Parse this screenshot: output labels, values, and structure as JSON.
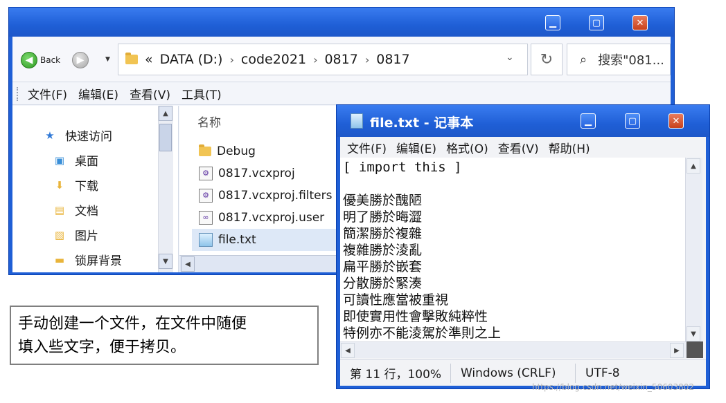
{
  "explorer": {
    "buttons": {
      "minimize": "▁",
      "maximize": "▢",
      "close": "✕"
    },
    "nav": {
      "back_label": "Back",
      "back_icon": "arrow-left-icon",
      "forward_icon": "arrow-right-icon"
    },
    "address": {
      "prefix": "«",
      "segments": [
        "DATA (D:)",
        "code2021",
        "0817",
        "0817"
      ],
      "separator": "›",
      "refresh": "↻"
    },
    "search": {
      "placeholder": "搜索\"081..."
    },
    "menu": [
      "文件(F)",
      "编辑(E)",
      "查看(V)",
      "工具(T)"
    ],
    "sidebar": {
      "items": [
        {
          "label": "快速访问",
          "icon": "star-icon",
          "glyph": "★",
          "color": "#2f78d6"
        },
        {
          "label": "桌面",
          "icon": "desktop-icon",
          "glyph": "▣",
          "color": "#3a8fd8"
        },
        {
          "label": "下载",
          "icon": "download-folder-icon",
          "glyph": "⬇",
          "color": "#e9b43a"
        },
        {
          "label": "文档",
          "icon": "documents-folder-icon",
          "glyph": "▤",
          "color": "#e9b43a"
        },
        {
          "label": "图片",
          "icon": "pictures-folder-icon",
          "glyph": "▧",
          "color": "#e9b43a"
        },
        {
          "label": "锁屏背景",
          "icon": "folder-icon",
          "glyph": "▬",
          "color": "#e9b43a"
        }
      ]
    },
    "files": {
      "header": "名称",
      "items": [
        {
          "name": "Debug",
          "icon": "folder-icon"
        },
        {
          "name": "0817.vcxproj",
          "icon": "vcxproj-file-icon"
        },
        {
          "name": "0817.vcxproj.filters",
          "icon": "vcxproj-filters-file-icon"
        },
        {
          "name": "0817.vcxproj.user",
          "icon": "visual-studio-file-icon"
        },
        {
          "name": "file.txt",
          "icon": "text-file-icon"
        }
      ]
    }
  },
  "notepad": {
    "title": "file.txt - 记事本",
    "buttons": {
      "minimize": "▁",
      "maximize": "▢",
      "close": "✕"
    },
    "menu": [
      "文件(F)",
      "编辑(E)",
      "格式(O)",
      "查看(V)",
      "帮助(H)"
    ],
    "first_line": "[ import this ]",
    "lines": [
      "",
      "優美勝於醜陋",
      "明了勝於晦澀",
      "簡潔勝於複雜",
      "複雜勝於淩亂",
      "扁平勝於嵌套",
      "分散勝於緊湊",
      "可讀性應當被重視",
      "即使實用性會擊敗純粹性",
      "特例亦不能淩駕於準則之上"
    ],
    "status": {
      "position": "第 11 行，100%",
      "line_ending": "Windows (CRLF)",
      "encoding": "UTF-8"
    }
  },
  "annotation": {
    "text_line1": "手动创建一个文件，在文件中随便",
    "text_line2": "填入些文字，便于拷贝。"
  },
  "watermark": "https://blog.csdn.net/weixin_50603802"
}
